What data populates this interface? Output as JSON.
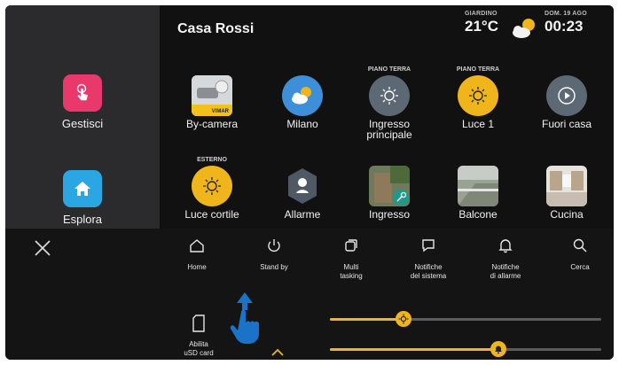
{
  "sidebar": {
    "items": [
      {
        "label": "Gestisci",
        "icon": "touch-hand-icon",
        "color": "#e8386c"
      },
      {
        "label": "Esplora",
        "icon": "home-icon",
        "color": "#2aa7e3"
      }
    ]
  },
  "header": {
    "title": "Casa Rossi",
    "weather_place": "GIARDINO",
    "temperature": "21°C",
    "weather_icon": "partly-cloudy-icon",
    "date": "DOM. 19 AGO",
    "time": "00:23"
  },
  "tiles": [
    {
      "caption": "",
      "label": "By-camera",
      "icon": "by-camera-icon",
      "badge": "VIMAR"
    },
    {
      "caption": "",
      "label": "Milano",
      "icon": "weather-icon"
    },
    {
      "caption": "PIANO TERRA",
      "label": "Ingresso principale",
      "icon": "bulb-icon"
    },
    {
      "caption": "PIANO TERRA",
      "label": "Luce 1",
      "icon": "bulb-icon"
    },
    {
      "caption": "",
      "label": "Fuori casa",
      "icon": "scenario-play-icon"
    },
    {
      "caption": "ESTERNO",
      "label": "Luce cortile",
      "icon": "bulb-icon"
    },
    {
      "caption": "",
      "label": "Allarme",
      "icon": "alarm-shield-icon"
    },
    {
      "caption": "",
      "label": "Ingresso",
      "icon": "door-key-photo"
    },
    {
      "caption": "",
      "label": "Balcone",
      "icon": "balcony-photo"
    },
    {
      "caption": "",
      "label": "Cucina",
      "icon": "kitchen-photo"
    }
  ],
  "toolbar": {
    "close_icon": "close-icon",
    "buttons": [
      {
        "label": "Home",
        "icon": "home-outline-icon"
      },
      {
        "label": "Stand by",
        "icon": "power-icon"
      },
      {
        "label": "Multi\ntasking",
        "icon": "multitasking-icon"
      },
      {
        "label": "Notifiche\ndel sistema",
        "icon": "chat-bubble-icon"
      },
      {
        "label": "Notifiche\ndi allarme",
        "icon": "bell-icon"
      },
      {
        "label": "Cerca",
        "icon": "search-icon"
      }
    ],
    "sd_card": {
      "label": "Abilita\nuSD card",
      "icon": "sd-card-icon"
    },
    "chevron_icon": "chevron-up-icon",
    "brightness_level": 0.27,
    "volume_level": 0.62,
    "accent": "#f1b51c"
  }
}
